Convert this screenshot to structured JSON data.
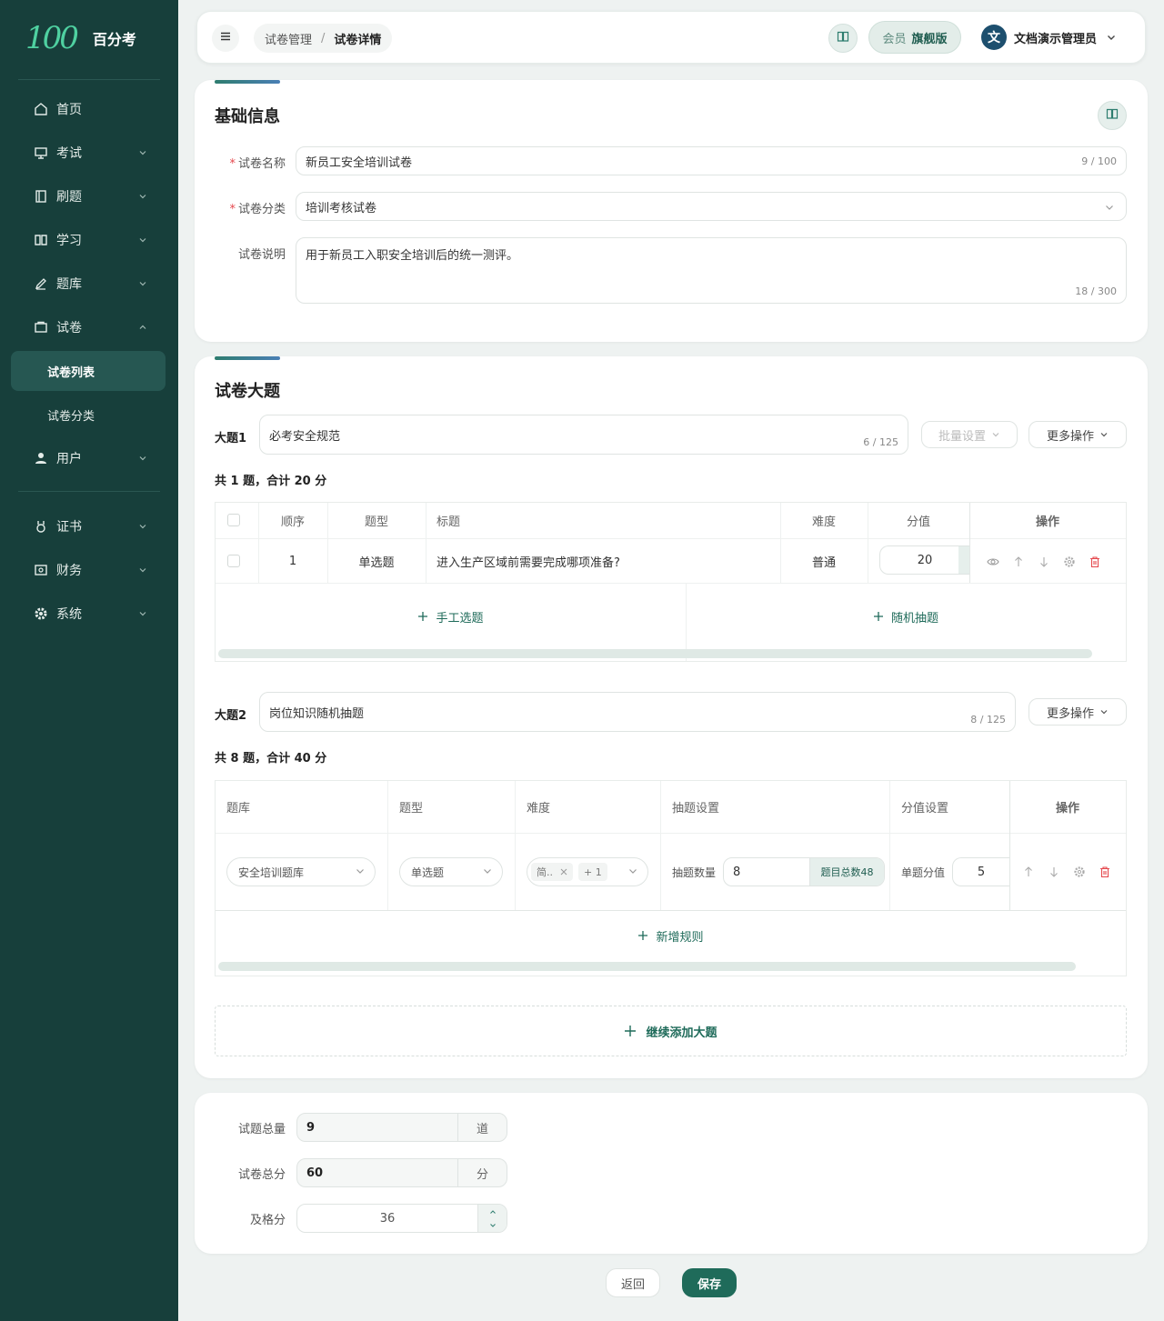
{
  "brand": {
    "logo": "100",
    "name": "百分考"
  },
  "sidebar": {
    "items": [
      {
        "label": "首页",
        "icon": "home-icon"
      },
      {
        "label": "考试",
        "icon": "monitor-icon"
      },
      {
        "label": "刷题",
        "icon": "notebook-icon"
      },
      {
        "label": "学习",
        "icon": "book-open-icon"
      },
      {
        "label": "题库",
        "icon": "pen-icon"
      },
      {
        "label": "试卷",
        "icon": "folder-icon"
      },
      {
        "label": "试卷列表"
      },
      {
        "label": "试卷分类"
      },
      {
        "label": "用户",
        "icon": "user-icon"
      },
      {
        "label": "证书",
        "icon": "medal-icon"
      },
      {
        "label": "财务",
        "icon": "wallet-icon"
      },
      {
        "label": "系统",
        "icon": "gear-icon"
      }
    ]
  },
  "header": {
    "breadcrumb": [
      "试卷管理",
      "试卷详情"
    ],
    "vip_label": "会员",
    "vip_value": "旗舰版",
    "user_avatar": "文",
    "user_name": "文档演示管理员"
  },
  "basic": {
    "title": "基础信息",
    "name_label": "试卷名称",
    "name_value": "新员工安全培训试卷",
    "name_count": "9 / 100",
    "cat_label": "试卷分类",
    "cat_value": "培训考核试卷",
    "desc_label": "试卷说明",
    "desc_value": "用于新员工入职安全培训后的统一测评。",
    "desc_count": "18 / 300"
  },
  "sections": {
    "title": "试卷大题",
    "s1": {
      "label": "大题1",
      "name": "必考安全规范",
      "count": "6 / 125",
      "batch": "批量设置",
      "more": "更多操作",
      "summary": "共 1 题，合计 20 分",
      "headers": [
        "顺序",
        "题型",
        "标题",
        "难度",
        "分值",
        "操作"
      ],
      "row": {
        "order": "1",
        "type": "单选题",
        "title": "进入生产区域前需要完成哪项准备?",
        "difficulty": "普通",
        "score": "20"
      },
      "add_manual": "手工选题",
      "add_random": "随机抽题"
    },
    "s2": {
      "label": "大题2",
      "name": "岗位知识随机抽题",
      "count": "8 / 125",
      "more": "更多操作",
      "summary": "共 8 题，合计 40 分",
      "headers": [
        "题库",
        "题型",
        "难度",
        "抽题设置",
        "分值设置",
        "操作"
      ],
      "row": {
        "bank": "安全培训题库",
        "type": "单选题",
        "tag1": "简..",
        "tag2": "+ 1",
        "draw_label": "抽题数量",
        "draw_value": "8",
        "total_badge": "题目总数48",
        "score_label": "单题分值",
        "score_value": "5"
      },
      "add_rule": "新增规则"
    },
    "add_section": "继续添加大题"
  },
  "totals": {
    "count_label": "试题总量",
    "count_value": "9",
    "count_unit": "道",
    "score_label": "试卷总分",
    "score_value": "60",
    "score_unit": "分",
    "pass_label": "及格分",
    "pass_value": "36"
  },
  "footer": {
    "back": "返回",
    "save": "保存"
  }
}
